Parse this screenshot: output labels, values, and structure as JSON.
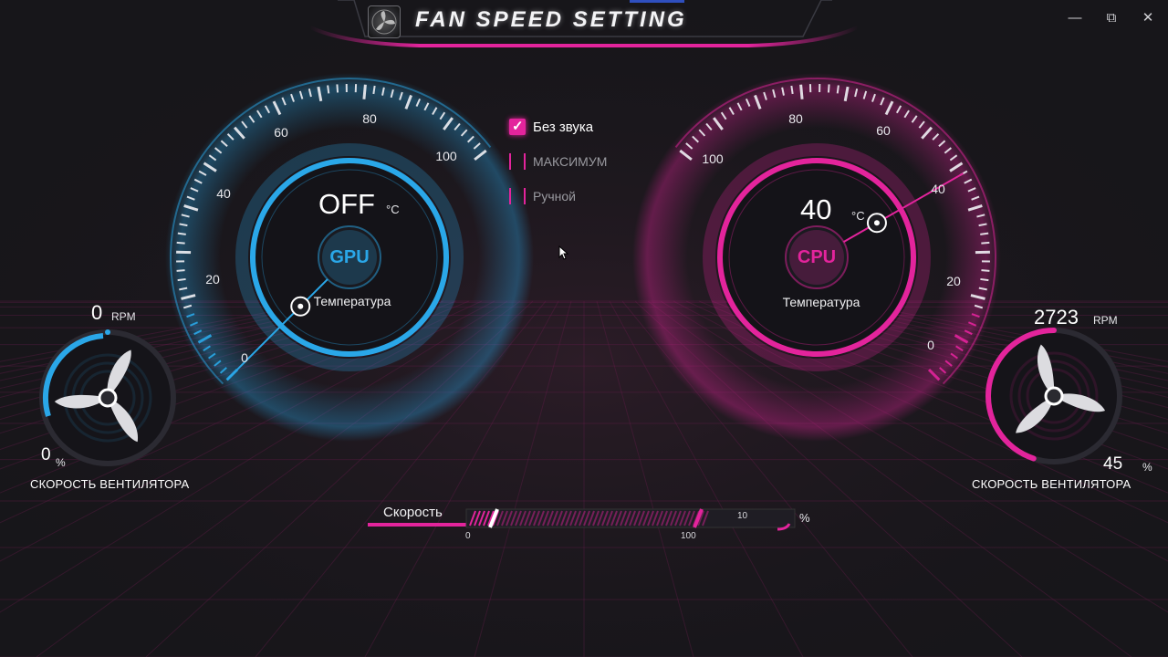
{
  "window": {
    "title": "FAN SPEED SETTING",
    "controls": {
      "minimize": "—",
      "maximize": "⧉",
      "close": "✕"
    }
  },
  "gpu": {
    "value": "OFF",
    "unit": "°C",
    "chip": "GPU",
    "label": "Температура",
    "scale": [
      "0",
      "20",
      "40",
      "60",
      "80",
      "100"
    ],
    "needle_value": 0,
    "accent": "#2aa7e8"
  },
  "cpu": {
    "value": "40",
    "unit": "°C",
    "chip": "CPU",
    "label": "Температура",
    "scale": [
      "0",
      "20",
      "40",
      "60",
      "80",
      "100"
    ],
    "needle_value": 40,
    "accent": "#e3249c"
  },
  "options": [
    {
      "label": "Без звука",
      "checked": true
    },
    {
      "label": "МАКСИМУМ",
      "checked": false
    },
    {
      "label": "Ручной",
      "checked": false
    }
  ],
  "fan_left": {
    "rpm": "0",
    "rpm_unit": "RPM",
    "percent": "0",
    "percent_unit": "%",
    "caption": "СКОРОСТЬ ВЕНТИЛЯТОРА",
    "level": 0.0,
    "accent": "#2aa7e8"
  },
  "fan_right": {
    "rpm": "2723",
    "rpm_unit": "RPM",
    "percent": "45",
    "percent_unit": "%",
    "caption": "СКОРОСТЬ ВЕНТИЛЯТОРА",
    "level": 0.45,
    "accent": "#e3249c"
  },
  "speed": {
    "label": "Скорость",
    "min_label": "0",
    "max_label": "100",
    "value": "10",
    "unit": "%",
    "level": 0.1
  }
}
